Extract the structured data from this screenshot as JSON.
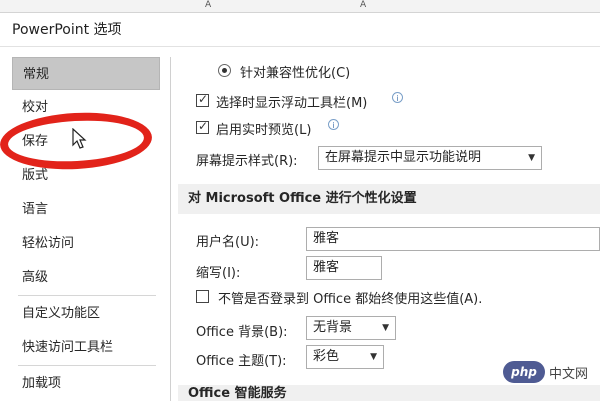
{
  "top_strip": {
    "glyph_a": "A",
    "glyph_b": "A"
  },
  "dialog": {
    "title": "PowerPoint 选项"
  },
  "sidebar": {
    "items": [
      {
        "label": "常规",
        "selected": true
      },
      {
        "label": "校对"
      },
      {
        "label": "保存"
      },
      {
        "label": "版式"
      },
      {
        "label": "语言"
      },
      {
        "label": "轻松访问"
      },
      {
        "label": "高级"
      },
      {
        "label": "自定义功能区"
      },
      {
        "label": "快速访问工具栏"
      },
      {
        "label": "加载项"
      }
    ]
  },
  "general": {
    "compat_radio": "针对兼容性优化(C)",
    "mini_toolbar": {
      "label": "选择时显示浮动工具栏(M)",
      "checked": true
    },
    "live_preview": {
      "label": "启用实时预览(L)",
      "checked": true
    },
    "screentip": {
      "label": "屏幕提示样式(R):",
      "value": "在屏幕提示中显示功能说明"
    }
  },
  "personalize": {
    "header": "对 Microsoft Office 进行个性化设置",
    "username": {
      "label": "用户名(U):",
      "value": "雅客"
    },
    "initials": {
      "label": "缩写(I):",
      "value": "雅客"
    },
    "always_use": {
      "label": "不管是否登录到 Office 都始终使用这些值(A).",
      "checked": false
    },
    "background": {
      "label": "Office 背景(B):",
      "value": "无背景"
    },
    "theme": {
      "label": "Office 主题(T):",
      "value": "彩色"
    }
  },
  "intelligent_services": {
    "header": "Office 智能服务"
  },
  "watermark": {
    "logo_text": "php",
    "site_text": "中文网"
  },
  "colors": {
    "annotation_red": "#e2231a",
    "selected_bg": "#c6c6c6"
  }
}
